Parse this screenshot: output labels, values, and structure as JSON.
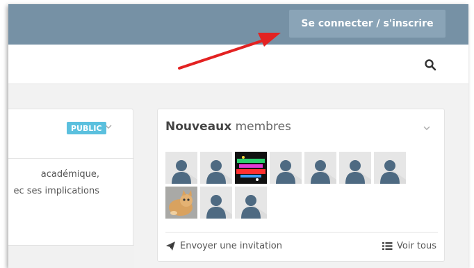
{
  "header": {
    "login_label": "Se connecter / s'inscrire"
  },
  "left_card": {
    "badge": "PUBLIC",
    "text_lines": [
      "académique,",
      "ec ses implications"
    ]
  },
  "members": {
    "title_strong": "Nouveaux",
    "title_light": "membres",
    "avatars": [
      {
        "kind": "default"
      },
      {
        "kind": "default"
      },
      {
        "kind": "photo-colorful"
      },
      {
        "kind": "default"
      },
      {
        "kind": "default"
      },
      {
        "kind": "default"
      },
      {
        "kind": "default"
      },
      {
        "kind": "photo-kitten"
      },
      {
        "kind": "default"
      },
      {
        "kind": "default"
      }
    ],
    "invite_label": "Envoyer une invitation",
    "view_all_label": "Voir tous"
  },
  "colors": {
    "topbar": "#7691a5",
    "button": "#8aa4b7",
    "badge": "#5bc0de",
    "avatar_silhouette": "#4e6a82",
    "annotation_arrow": "#e32222"
  }
}
